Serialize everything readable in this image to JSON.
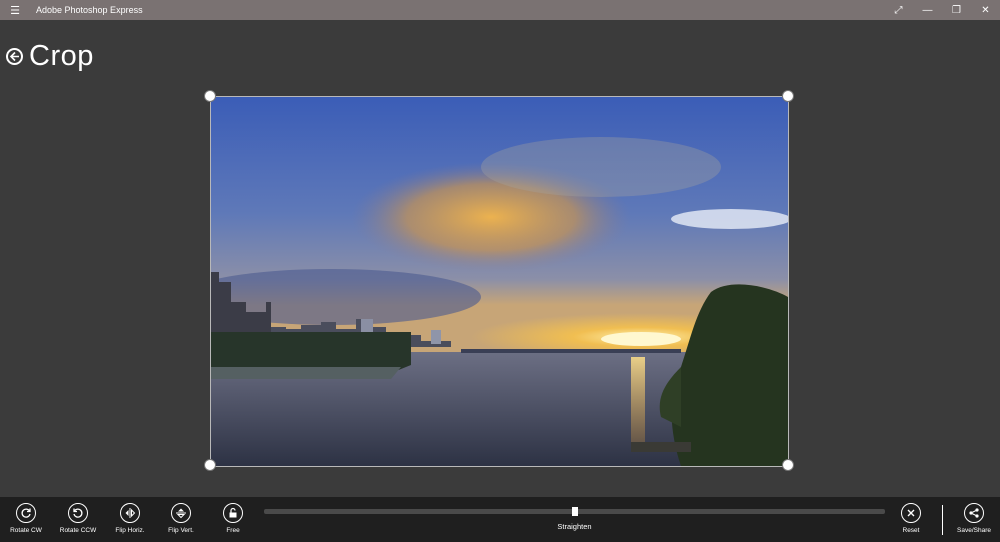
{
  "app": {
    "title": "Adobe Photoshop Express",
    "menu_icon": "hamburger-icon",
    "window_controls": [
      "fullscreen-icon",
      "minimize-icon",
      "restore-icon",
      "close-icon"
    ]
  },
  "header": {
    "back_icon": "back-arrow-icon",
    "title": "Crop"
  },
  "photo": {
    "description_icon": "landscape-photo"
  },
  "toolbar": {
    "tools": [
      {
        "label": "Rotate CW",
        "icon": "rotate-cw-icon"
      },
      {
        "label": "Rotate CCW",
        "icon": "rotate-ccw-icon"
      },
      {
        "label": "Flip Horiz.",
        "icon": "flip-horizontal-icon"
      },
      {
        "label": "Flip Vert.",
        "icon": "flip-vertical-icon"
      },
      {
        "label": "Free",
        "icon": "lock-icon"
      }
    ],
    "straighten": {
      "label": "Straighten",
      "value": 0.5
    },
    "reset": {
      "label": "Reset",
      "icon": "reset-x-icon"
    },
    "save": {
      "label": "Save/Share",
      "icon": "share-icon"
    }
  },
  "colors": {
    "titlebar": "#7a7272",
    "canvas": "#3b3b3b",
    "toolbar": "#1f1f1f"
  }
}
